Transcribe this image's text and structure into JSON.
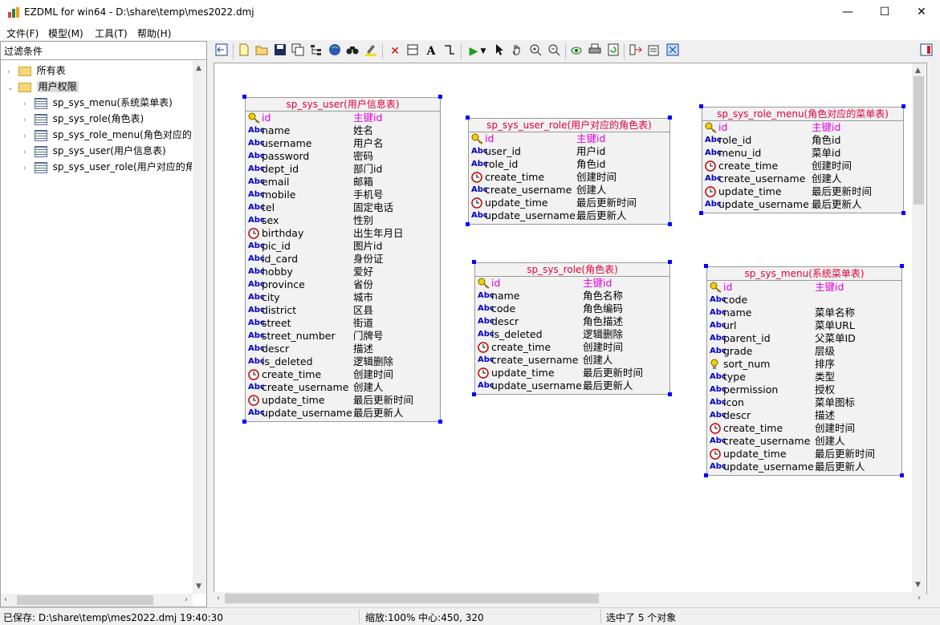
{
  "window": {
    "title": "EZDML for win64 - D:\\share\\temp\\mes2022.dmj",
    "minimize": "—",
    "maximize": "☐",
    "close": "✕"
  },
  "menu": {
    "items": [
      "文件(F)",
      "模型(M)",
      "工具(T)",
      "帮助(H)"
    ]
  },
  "sidebar": {
    "filter_label": "过滤条件",
    "groups": [
      {
        "label": "所有表",
        "expanded": false
      },
      {
        "label": "用户权限",
        "expanded": true,
        "selected": true
      }
    ],
    "tables": [
      "sp_sys_menu(系统菜单表)",
      "sp_sys_role(角色表)",
      "sp_sys_role_menu(角色对应的菜单表)",
      "sp_sys_user(用户信息表)",
      "sp_sys_user_role(用户对应的角色表)"
    ]
  },
  "toolbar": {
    "icons": [
      "back-icon",
      "new-file-icon",
      "open-folder-icon",
      "save-icon",
      "copy-icon",
      "hierarchy-icon",
      "globe-icon",
      "binoculars-icon",
      "highlight-icon",
      "delete-icon",
      "rectangle-icon",
      "text-icon",
      "connector-icon",
      "run-icon",
      "dropdown-arrow-icon",
      "pointer-icon",
      "hand-icon",
      "zoom-in-icon",
      "zoom-out-icon",
      "eye-icon",
      "printer-icon",
      "refresh-icon",
      "import-icon",
      "properties-icon",
      "fit-screen-icon",
      "panel-toggle-icon"
    ]
  },
  "entities": [
    {
      "id": "sp_sys_user",
      "title": "sp_sys_user(用户信息表)",
      "fields": [
        {
          "name": "id",
          "cn": "主键id",
          "type": "pk"
        },
        {
          "name": "name",
          "cn": "姓名",
          "type": "str"
        },
        {
          "name": "username",
          "cn": "用户名",
          "type": "str"
        },
        {
          "name": "password",
          "cn": "密码",
          "type": "str"
        },
        {
          "name": "dept_id",
          "cn": "部门id",
          "type": "str"
        },
        {
          "name": "email",
          "cn": "邮箱",
          "type": "str"
        },
        {
          "name": "mobile",
          "cn": "手机号",
          "type": "str"
        },
        {
          "name": "tel",
          "cn": "固定电话",
          "type": "str"
        },
        {
          "name": "sex",
          "cn": "性别",
          "type": "str"
        },
        {
          "name": "birthday",
          "cn": "出生年月日",
          "type": "date"
        },
        {
          "name": "pic_id",
          "cn": "图片id",
          "type": "str"
        },
        {
          "name": "id_card",
          "cn": "身份证",
          "type": "str"
        },
        {
          "name": "hobby",
          "cn": "爱好",
          "type": "str"
        },
        {
          "name": "province",
          "cn": "省份",
          "type": "str"
        },
        {
          "name": "city",
          "cn": "城市",
          "type": "str"
        },
        {
          "name": "district",
          "cn": "区县",
          "type": "str"
        },
        {
          "name": "street",
          "cn": "街道",
          "type": "str"
        },
        {
          "name": "street_number",
          "cn": "门牌号",
          "type": "str"
        },
        {
          "name": "descr",
          "cn": "描述",
          "type": "str"
        },
        {
          "name": "is_deleted",
          "cn": "逻辑删除",
          "type": "str"
        },
        {
          "name": "create_time",
          "cn": "创建时间",
          "type": "date"
        },
        {
          "name": "create_username",
          "cn": "创建人",
          "type": "str"
        },
        {
          "name": "update_time",
          "cn": "最后更新时间",
          "type": "date"
        },
        {
          "name": "update_username",
          "cn": "最后更新人",
          "type": "str"
        }
      ]
    },
    {
      "id": "sp_sys_user_role",
      "title": "sp_sys_user_role(用户对应的角色表)",
      "fields": [
        {
          "name": "id",
          "cn": "主键id",
          "type": "pk"
        },
        {
          "name": "user_id",
          "cn": "用户id",
          "type": "str"
        },
        {
          "name": "role_id",
          "cn": "角色id",
          "type": "str"
        },
        {
          "name": "create_time",
          "cn": "创建时间",
          "type": "date"
        },
        {
          "name": "create_username",
          "cn": "创建人",
          "type": "str"
        },
        {
          "name": "update_time",
          "cn": "最后更新时间",
          "type": "date"
        },
        {
          "name": "update_username",
          "cn": "最后更新人",
          "type": "str"
        }
      ]
    },
    {
      "id": "sp_sys_role_menu",
      "title": "sp_sys_role_menu(角色对应的菜单表)",
      "fields": [
        {
          "name": "id",
          "cn": "主键id",
          "type": "pk"
        },
        {
          "name": "role_id",
          "cn": "角色id",
          "type": "str"
        },
        {
          "name": "menu_id",
          "cn": "菜单id",
          "type": "str"
        },
        {
          "name": "create_time",
          "cn": "创建时间",
          "type": "date"
        },
        {
          "name": "create_username",
          "cn": "创建人",
          "type": "str"
        },
        {
          "name": "update_time",
          "cn": "最后更新时间",
          "type": "date"
        },
        {
          "name": "update_username",
          "cn": "最后更新人",
          "type": "str"
        }
      ]
    },
    {
      "id": "sp_sys_role",
      "title": "sp_sys_role(角色表)",
      "fields": [
        {
          "name": "id",
          "cn": "主键id",
          "type": "pk"
        },
        {
          "name": "name",
          "cn": "角色名称",
          "type": "str"
        },
        {
          "name": "code",
          "cn": "角色编码",
          "type": "str"
        },
        {
          "name": "descr",
          "cn": "角色描述",
          "type": "str"
        },
        {
          "name": "is_deleted",
          "cn": "逻辑删除",
          "type": "str"
        },
        {
          "name": "create_time",
          "cn": "创建时间",
          "type": "date"
        },
        {
          "name": "create_username",
          "cn": "创建人",
          "type": "str"
        },
        {
          "name": "update_time",
          "cn": "最后更新时间",
          "type": "date"
        },
        {
          "name": "update_username",
          "cn": "最后更新人",
          "type": "str"
        }
      ]
    },
    {
      "id": "sp_sys_menu",
      "title": "sp_sys_menu(系统菜单表)",
      "fields": [
        {
          "name": "id",
          "cn": "主键id",
          "type": "pk"
        },
        {
          "name": "code",
          "cn": "",
          "type": "str"
        },
        {
          "name": "name",
          "cn": "菜单名称",
          "type": "str"
        },
        {
          "name": "url",
          "cn": "菜单URL",
          "type": "str"
        },
        {
          "name": "parent_id",
          "cn": "父菜单ID",
          "type": "str"
        },
        {
          "name": "grade",
          "cn": "层级",
          "type": "str"
        },
        {
          "name": "sort_num",
          "cn": "排序",
          "type": "num"
        },
        {
          "name": "type",
          "cn": "类型",
          "type": "str"
        },
        {
          "name": "permission",
          "cn": "授权",
          "type": "str"
        },
        {
          "name": "icon",
          "cn": "菜单图标",
          "type": "str"
        },
        {
          "name": "descr",
          "cn": "描述",
          "type": "str"
        },
        {
          "name": "create_time",
          "cn": "创建时间",
          "type": "date"
        },
        {
          "name": "create_username",
          "cn": "创建人",
          "type": "str"
        },
        {
          "name": "update_time",
          "cn": "最后更新时间",
          "type": "date"
        },
        {
          "name": "update_username",
          "cn": "最后更新人",
          "type": "str"
        }
      ]
    }
  ],
  "status": {
    "saved": "已保存: D:\\share\\temp\\mes2022.dmj 19:40:30",
    "zoom": "缩放:100% 中心:450, 320",
    "selection": "选中了 5 个对象"
  }
}
